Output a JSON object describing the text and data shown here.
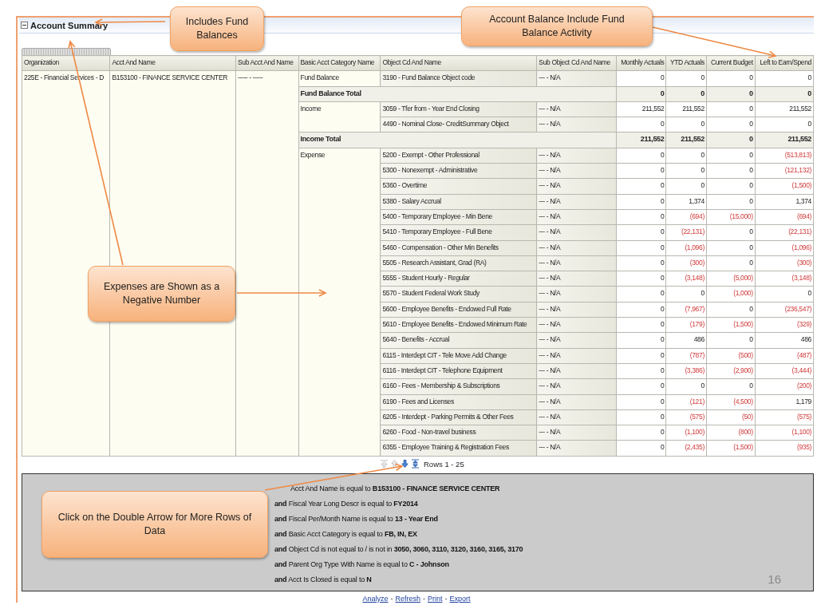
{
  "panel": {
    "title": "Account Summary",
    "expanded": true
  },
  "table": {
    "columns": [
      "Organization",
      "Acct And Name",
      "Sub Acct And Name",
      "Basic Acct Category Name",
      "Object Cd And Name",
      "Sub Object Cd And Name",
      "Monthly Actuals",
      "YTD Actuals",
      "Current Budget",
      "Left to Earn/Spend"
    ],
    "organization": "225E - Financial Services - D",
    "account": "B153100 - FINANCE SERVICE CENTER",
    "sub_account": "----- - -----",
    "categories": [
      {
        "name": "Fund Balance",
        "rows": [
          {
            "object": "3190 - Fund Balance Object code",
            "sub_object": "--- - N/A",
            "values": [
              "0",
              "0",
              "0",
              "0"
            ],
            "negative": [
              false,
              false,
              false,
              false
            ]
          }
        ],
        "total": {
          "label": "Fund Balance Total",
          "values": [
            "0",
            "0",
            "0",
            "0"
          ],
          "negative": [
            false,
            false,
            false,
            false
          ]
        }
      },
      {
        "name": "Income",
        "rows": [
          {
            "object": "3059 - Tfer from - Year End Closing",
            "sub_object": "--- - N/A",
            "values": [
              "211,552",
              "211,552",
              "0",
              "211,552"
            ],
            "negative": [
              false,
              false,
              false,
              false
            ]
          },
          {
            "object": "4490 - Nominal Close- CreditSummary Object",
            "sub_object": "--- - N/A",
            "values": [
              "0",
              "0",
              "0",
              "0"
            ],
            "negative": [
              false,
              false,
              false,
              false
            ]
          }
        ],
        "total": {
          "label": "Income Total",
          "values": [
            "211,552",
            "211,552",
            "0",
            "211,552"
          ],
          "negative": [
            false,
            false,
            false,
            false
          ]
        }
      },
      {
        "name": "Expense",
        "rows": [
          {
            "object": "5200 - Exempt - Other Professional",
            "sub_object": "--- - N/A",
            "values": [
              "0",
              "0",
              "0",
              "(513,813)"
            ],
            "negative": [
              false,
              false,
              false,
              true
            ]
          },
          {
            "object": "5300 - Nonexempt - Administrative",
            "sub_object": "--- - N/A",
            "values": [
              "0",
              "0",
              "0",
              "(121,132)"
            ],
            "negative": [
              false,
              false,
              false,
              true
            ]
          },
          {
            "object": "5360 - Overtime",
            "sub_object": "--- - N/A",
            "values": [
              "0",
              "0",
              "0",
              "(1,500)"
            ],
            "negative": [
              false,
              false,
              false,
              true
            ]
          },
          {
            "object": "5380 - Salary Accrual",
            "sub_object": "--- - N/A",
            "values": [
              "0",
              "1,374",
              "0",
              "1,374"
            ],
            "negative": [
              false,
              false,
              false,
              false
            ]
          },
          {
            "object": "5400 - Temporary Employee - Min Bene",
            "sub_object": "--- - N/A",
            "values": [
              "0",
              "(694)",
              "(15,000)",
              "(694)"
            ],
            "negative": [
              false,
              true,
              true,
              true
            ]
          },
          {
            "object": "5410 - Temporary Employee - Full Bene",
            "sub_object": "--- - N/A",
            "values": [
              "0",
              "(22,131)",
              "0",
              "(22,131)"
            ],
            "negative": [
              false,
              true,
              false,
              true
            ]
          },
          {
            "object": "5460 - Compensation - Other Min Benefits",
            "sub_object": "--- - N/A",
            "values": [
              "0",
              "(1,096)",
              "0",
              "(1,096)"
            ],
            "negative": [
              false,
              true,
              false,
              true
            ]
          },
          {
            "object": "5505 - Research Assistant, Grad (RA)",
            "sub_object": "--- - N/A",
            "values": [
              "0",
              "(300)",
              "0",
              "(300)"
            ],
            "negative": [
              false,
              true,
              false,
              true
            ]
          },
          {
            "object": "5555 - Student Hourly - Regular",
            "sub_object": "--- - N/A",
            "values": [
              "0",
              "(3,148)",
              "(5,000)",
              "(3,148)"
            ],
            "negative": [
              false,
              true,
              true,
              true
            ]
          },
          {
            "object": "5570 - Student Federal Work Study",
            "sub_object": "--- - N/A",
            "values": [
              "0",
              "0",
              "(1,000)",
              "0"
            ],
            "negative": [
              false,
              false,
              true,
              false
            ]
          },
          {
            "object": "5600 - Employee Benefits - Endowed Full Rate",
            "sub_object": "--- - N/A",
            "values": [
              "0",
              "(7,967)",
              "0",
              "(236,547)"
            ],
            "negative": [
              false,
              true,
              false,
              true
            ]
          },
          {
            "object": "5610 - Employee Benefits - Endowed Minimum Rate",
            "sub_object": "--- - N/A",
            "values": [
              "0",
              "(179)",
              "(1,500)",
              "(329)"
            ],
            "negative": [
              false,
              true,
              true,
              true
            ]
          },
          {
            "object": "5640 - Benefits - Accrual",
            "sub_object": "--- - N/A",
            "values": [
              "0",
              "486",
              "0",
              "486"
            ],
            "negative": [
              false,
              false,
              false,
              false
            ]
          },
          {
            "object": "6115 - Interdept CIT - Tele Move Add Change",
            "sub_object": "--- - N/A",
            "values": [
              "0",
              "(787)",
              "(500)",
              "(487)"
            ],
            "negative": [
              false,
              true,
              true,
              true
            ]
          },
          {
            "object": "6116 - Interdept CIT - Telephone Equipment",
            "sub_object": "--- - N/A",
            "values": [
              "0",
              "(3,386)",
              "(2,900)",
              "(3,444)"
            ],
            "negative": [
              false,
              true,
              true,
              true
            ]
          },
          {
            "object": "6160 - Fees - Membership & Subscriptions",
            "sub_object": "--- - N/A",
            "values": [
              "0",
              "0",
              "0",
              "(200)"
            ],
            "negative": [
              false,
              false,
              false,
              true
            ]
          },
          {
            "object": "6190 - Fees and Licenses",
            "sub_object": "--- - N/A",
            "values": [
              "0",
              "(121)",
              "(4,500)",
              "1,179"
            ],
            "negative": [
              false,
              true,
              true,
              false
            ]
          },
          {
            "object": "6205 - Interdept - Parking Permits & Other Fees",
            "sub_object": "--- - N/A",
            "values": [
              "0",
              "(575)",
              "(50)",
              "(575)"
            ],
            "negative": [
              false,
              true,
              true,
              true
            ]
          },
          {
            "object": "6260 - Food - Non-travel business",
            "sub_object": "--- - N/A",
            "values": [
              "0",
              "(1,100)",
              "(800)",
              "(1,100)"
            ],
            "negative": [
              false,
              true,
              true,
              true
            ]
          },
          {
            "object": "6355 - Employee Training & Registration Fees",
            "sub_object": "--- - N/A",
            "values": [
              "0",
              "(2,435)",
              "(1,500)",
              "(935)"
            ],
            "negative": [
              false,
              true,
              true,
              true
            ]
          }
        ]
      }
    ]
  },
  "pagination": {
    "label": "Rows 1 - 25"
  },
  "filters": [
    "Acct And Name is equal to **B153100 - FINANCE SERVICE CENTER**",
    "**and** Fiscal Year Long Descr is equal to **FY2014**",
    "**and** Fiscal Per/Month Name is equal to **13 - Year End**",
    "**and** Basic Acct Category is equal to **FB, IN, EX**",
    "**and** Object Cd is not equal to / is not in **3050, 3060, 3110, 3120, 3160, 3165, 3170**",
    "**and** Parent Org Type With Name is equal to **C - Johnson**",
    "**and** Acct Is Closed is equal to **N**"
  ],
  "footer_links": {
    "separator": "-",
    "links": [
      "Analyze",
      "Refresh",
      "Print",
      "Export"
    ]
  },
  "slide_number": "16",
  "callouts": [
    "Includes Fund Balances",
    "Account Balance Include Fund Balance Activity",
    "Expenses are Shown as a Negative Number",
    "Click on the Double Arrow for More Rows of Data"
  ]
}
